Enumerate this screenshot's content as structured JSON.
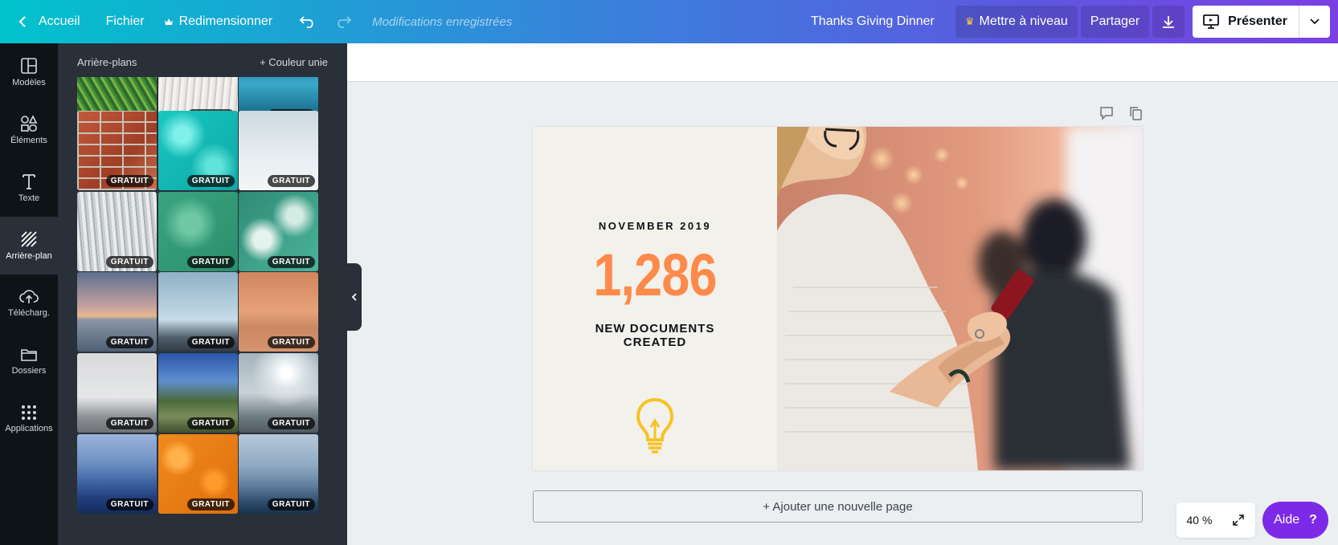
{
  "topbar": {
    "back_label": "Accueil",
    "file_label": "Fichier",
    "resize_label": "Redimensionner",
    "status": "Modifications enregistrées",
    "doc_title": "Thanks Giving Dinner",
    "upgrade_label": "Mettre à niveau",
    "share_label": "Partager",
    "present_label": "Présenter"
  },
  "rail": {
    "items": [
      {
        "label": "Modèles",
        "icon": "templates-icon"
      },
      {
        "label": "Éléments",
        "icon": "elements-icon"
      },
      {
        "label": "Texte",
        "icon": "text-icon"
      },
      {
        "label": "Arrière-plan",
        "icon": "background-icon"
      },
      {
        "label": "Télécharg.",
        "icon": "upload-icon"
      },
      {
        "label": "Dossiers",
        "icon": "folder-icon"
      },
      {
        "label": "Applications",
        "icon": "apps-icon"
      }
    ],
    "active_index": 3
  },
  "panel": {
    "title": "Arrière-plans",
    "add_solid": "+ Couleur unie",
    "badge": "GRATUIT",
    "tiles": [
      {
        "name": "palm-leaves",
        "free": false
      },
      {
        "name": "white-wood",
        "free": true
      },
      {
        "name": "blue-water-top",
        "free": true
      },
      {
        "name": "brick-wall",
        "free": true
      },
      {
        "name": "turquoise-pool",
        "free": true
      },
      {
        "name": "misty-sky",
        "free": true
      },
      {
        "name": "snowy-forest",
        "free": true
      },
      {
        "name": "green-water",
        "free": true
      },
      {
        "name": "sea-foam",
        "free": true
      },
      {
        "name": "sunset-sea",
        "free": true
      },
      {
        "name": "mountain-sky",
        "free": true
      },
      {
        "name": "desert-dune",
        "free": true
      },
      {
        "name": "foggy-city",
        "free": true
      },
      {
        "name": "blue-mountains",
        "free": true
      },
      {
        "name": "sun-mist-trees",
        "free": true
      },
      {
        "name": "blue-ridges",
        "free": true
      },
      {
        "name": "orange-poppies",
        "free": true
      },
      {
        "name": "blue-haze-hills",
        "free": true
      }
    ]
  },
  "design": {
    "date": "NOVEMBER 2019",
    "number": "1,286",
    "label_line1": "NEW DOCUMENTS",
    "label_line2": "CREATED",
    "accent": "#fd8a4a",
    "bulb_color": "#f7c325"
  },
  "canvas": {
    "add_page_label": "+ Ajouter une nouvelle page"
  },
  "footer": {
    "zoom": "40 %",
    "help_label": "Aide",
    "help_icon": "?"
  },
  "colors": {
    "brand_purple": "#7d2ae8",
    "topbar_start": "#01c3cc",
    "topbar_end": "#7b3fe4"
  }
}
